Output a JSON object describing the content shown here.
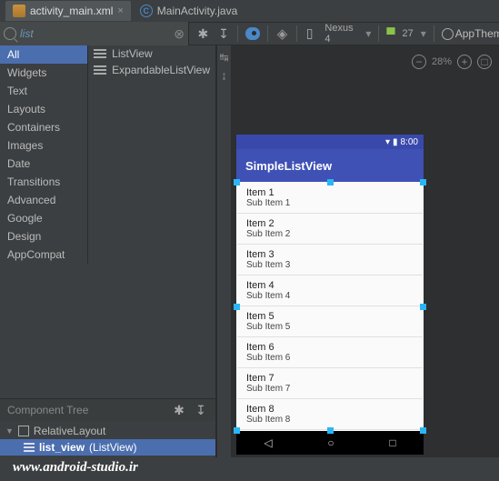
{
  "tabs": [
    {
      "label": "activity_main.xml",
      "active": true
    },
    {
      "label": "MainActivity.java",
      "active": false
    }
  ],
  "search": {
    "value": "list"
  },
  "toolbar": {
    "device": "Nexus 4",
    "api": "27",
    "theme": "AppThem"
  },
  "palette": {
    "categories": [
      "All",
      "Widgets",
      "Text",
      "Layouts",
      "Containers",
      "Images",
      "Date",
      "Transitions",
      "Advanced",
      "Google",
      "Design",
      "AppCompat"
    ],
    "selected": 0,
    "views": [
      "ListView",
      "ExpandableListView"
    ]
  },
  "componentTree": {
    "title": "Component Tree",
    "root": {
      "label": "RelativeLayout"
    },
    "child": {
      "id": "list_view",
      "type": "(ListView)"
    }
  },
  "zoom": {
    "level": "28%"
  },
  "preview": {
    "clock": "8:00",
    "appTitle": "SimpleListView",
    "items": [
      {
        "t": "Item 1",
        "s": "Sub Item 1"
      },
      {
        "t": "Item 2",
        "s": "Sub Item 2"
      },
      {
        "t": "Item 3",
        "s": "Sub Item 3"
      },
      {
        "t": "Item 4",
        "s": "Sub Item 4"
      },
      {
        "t": "Item 5",
        "s": "Sub Item 5"
      },
      {
        "t": "Item 6",
        "s": "Sub Item 6"
      },
      {
        "t": "Item 7",
        "s": "Sub Item 7"
      },
      {
        "t": "Item 8",
        "s": "Sub Item 8"
      }
    ]
  },
  "watermark": "www.android-studio.ir"
}
